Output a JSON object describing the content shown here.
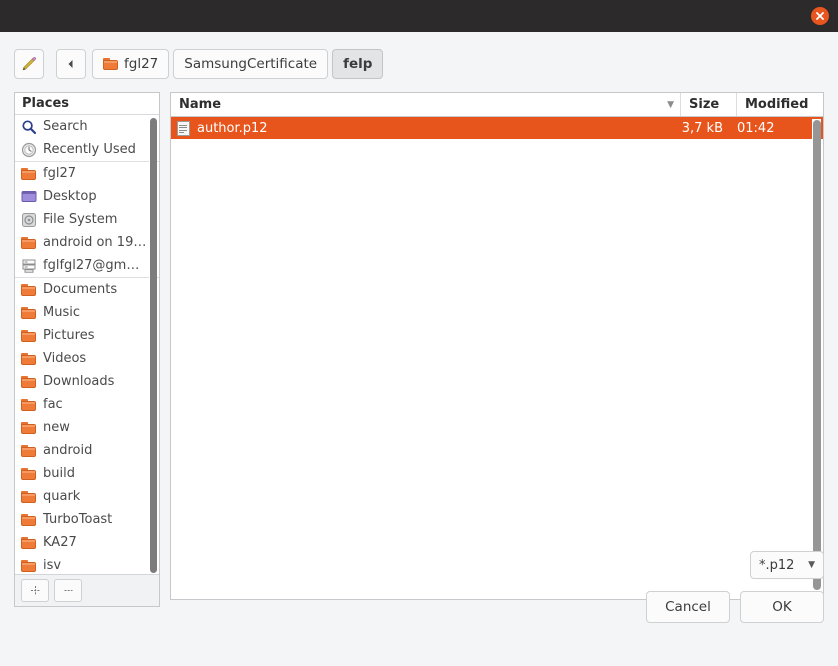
{
  "window": {
    "titlebar_color": "#2d2a2b",
    "close_icon": "close-icon"
  },
  "toolbar": {
    "edit_icon": "pencil-icon",
    "back_icon": "chevron-left-icon",
    "breadcrumbs": [
      {
        "label": "fgl27",
        "icon": "folder-icon",
        "active": false
      },
      {
        "label": "SamsungCertificate",
        "icon": null,
        "active": false
      },
      {
        "label": "felp",
        "icon": null,
        "active": true
      }
    ]
  },
  "places": {
    "header": "Places",
    "items": [
      {
        "label": "Search",
        "icon": "search-icon",
        "separator_before": false
      },
      {
        "label": "Recently Used",
        "icon": "clock-icon",
        "separator_before": false
      },
      {
        "label": "fgl27",
        "icon": "folder-icon",
        "separator_before": true
      },
      {
        "label": "Desktop",
        "icon": "desktop-icon",
        "separator_before": false
      },
      {
        "label": "File System",
        "icon": "disk-icon",
        "separator_before": false
      },
      {
        "label": "android on 19…",
        "icon": "folder-icon",
        "separator_before": false
      },
      {
        "label": "fglfgl27@gm…",
        "icon": "server-icon",
        "separator_before": false
      },
      {
        "label": "Documents",
        "icon": "folder-icon",
        "separator_before": true
      },
      {
        "label": "Music",
        "icon": "folder-icon",
        "separator_before": false
      },
      {
        "label": "Pictures",
        "icon": "folder-icon",
        "separator_before": false
      },
      {
        "label": "Videos",
        "icon": "folder-icon",
        "separator_before": false
      },
      {
        "label": "Downloads",
        "icon": "folder-icon",
        "separator_before": false
      },
      {
        "label": "fac",
        "icon": "folder-icon",
        "separator_before": false
      },
      {
        "label": "new",
        "icon": "folder-icon",
        "separator_before": false
      },
      {
        "label": "android",
        "icon": "folder-icon",
        "separator_before": false
      },
      {
        "label": "build",
        "icon": "folder-icon",
        "separator_before": false
      },
      {
        "label": "quark",
        "icon": "folder-icon",
        "separator_before": false
      },
      {
        "label": "TurboToast",
        "icon": "folder-icon",
        "separator_before": false
      },
      {
        "label": "KA27",
        "icon": "folder-icon",
        "separator_before": false
      },
      {
        "label": "isv",
        "icon": "folder-icon",
        "separator_before": false
      }
    ],
    "add_label": "+",
    "remove_label": "—"
  },
  "filelist": {
    "columns": {
      "name": "Name",
      "size": "Size",
      "modified": "Modified",
      "sort_arrow": "▼"
    },
    "rows": [
      {
        "name": "author.p12",
        "size": "3,7 kB",
        "modified": "01:42",
        "icon": "file-icon",
        "selected": true
      }
    ],
    "selection_color": "#e8551c"
  },
  "filter": {
    "value": "*.p12",
    "caret": "▼"
  },
  "actions": {
    "cancel_label": "Cancel",
    "ok_label": "OK"
  }
}
